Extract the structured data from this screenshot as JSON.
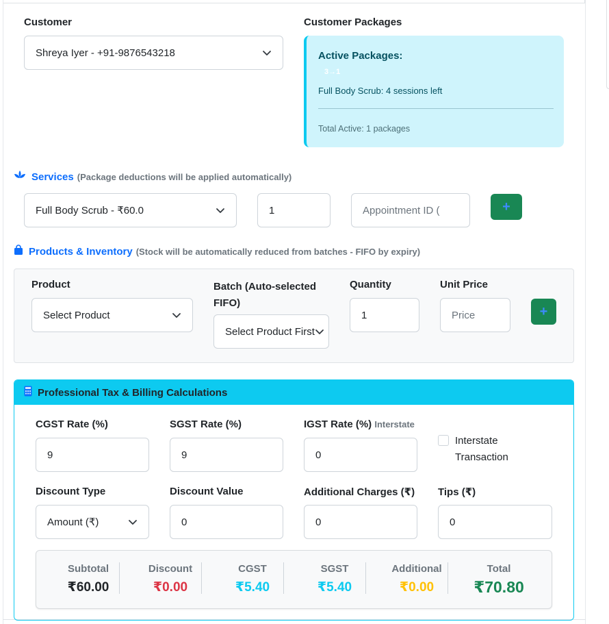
{
  "customer": {
    "label": "Customer",
    "selected": "Shreya Iyer - +91-9876543218"
  },
  "packages": {
    "label": "Customer Packages",
    "title": "Active Packages:",
    "badge": "3→1",
    "item": "Full Body Scrub: 4 sessions left",
    "total": "Total Active: 1 packages"
  },
  "services": {
    "title": "Services",
    "note": "(Package deductions will be applied automatically)",
    "service_selected": "Full Body Scrub - ₹60.0",
    "quantity": "1",
    "appointment_placeholder": "Appointment ID (",
    "add_label": "+"
  },
  "products": {
    "title": "Products & Inventory",
    "note": "(Stock will be automatically reduced from batches - FIFO by expiry)",
    "product_label": "Product",
    "product_selected": "Select Product",
    "batch_label": "Batch (Auto-selected FIFO)",
    "batch_selected": "Select Product First",
    "quantity_label": "Quantity",
    "quantity": "1",
    "unit_price_label": "Unit Price",
    "unit_price_placeholder": "Price",
    "add_label": "+"
  },
  "tax": {
    "title": "Professional Tax & Billing Calculations",
    "cgst_label": "CGST Rate (%)",
    "cgst": "9",
    "sgst_label": "SGST Rate (%)",
    "sgst": "9",
    "igst_label": "IGST Rate (%)",
    "igst_note": "Interstate",
    "igst": "0",
    "interstate_label": "Interstate Transaction",
    "interstate_checked": false,
    "discount_type_label": "Discount Type",
    "discount_type": "Amount (₹)",
    "discount_value_label": "Discount Value",
    "discount_value": "0",
    "additional_label": "Additional Charges (₹)",
    "additional": "0",
    "tips_label": "Tips (₹)",
    "tips": "0"
  },
  "summary": {
    "subtotal_label": "Subtotal",
    "subtotal": "₹60.00",
    "discount_label": "Discount",
    "discount": "₹0.00",
    "cgst_label": "CGST",
    "cgst": "₹5.40",
    "sgst_label": "SGST",
    "sgst": "₹5.40",
    "additional_label": "Additional",
    "additional": "₹0.00",
    "total_label": "Total",
    "total": "₹70.80"
  },
  "colors": {
    "primary": "#0d6efd",
    "success": "#198754",
    "info": "#0dcaf0",
    "danger": "#dc3545",
    "warning": "#ffc107",
    "info_bg": "#cff4fc"
  },
  "icons": {
    "services": "spa-icon",
    "products": "shopping-bag-icon",
    "tax": "calculator-icon",
    "select": "chevron-down-icon",
    "add": "plus-icon"
  }
}
